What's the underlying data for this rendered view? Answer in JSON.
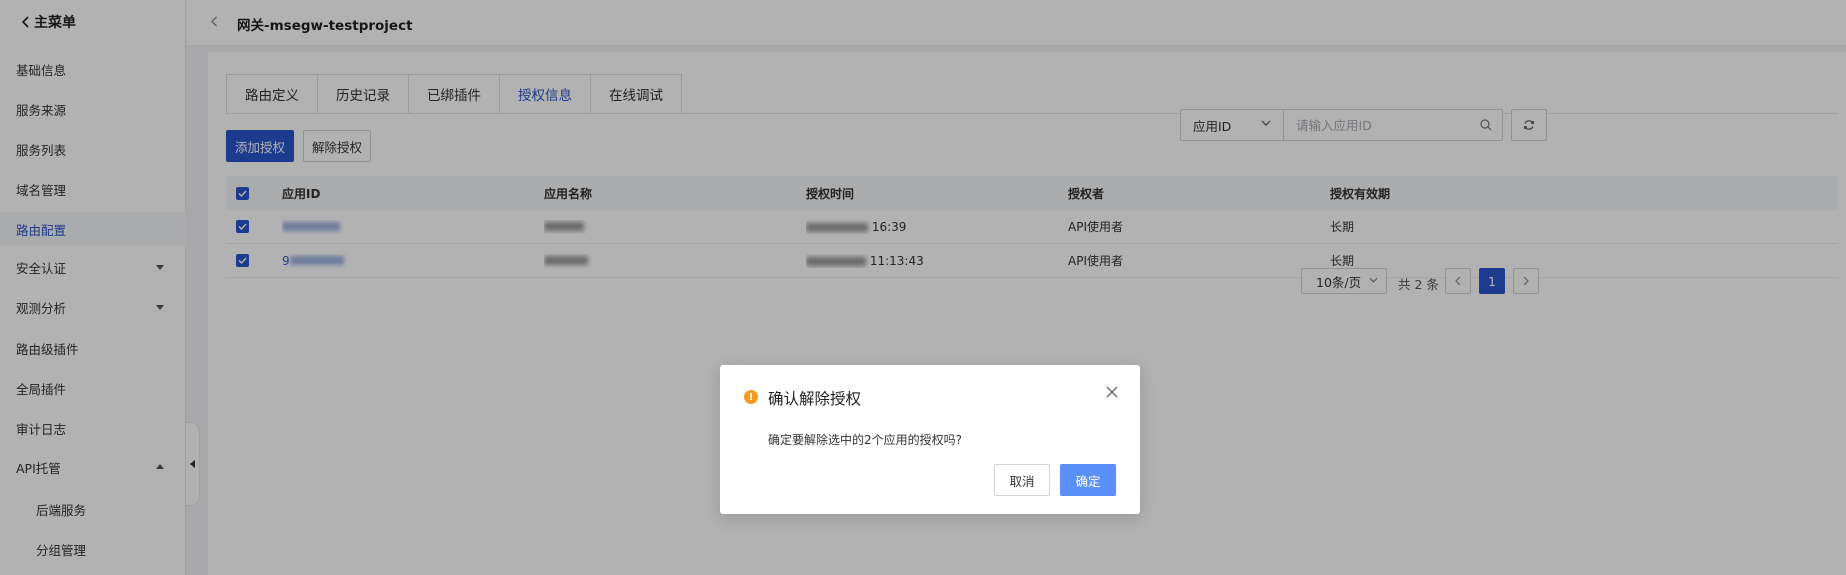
{
  "sidebar": {
    "main_menu": "主菜单",
    "items": [
      {
        "label": "基础信息"
      },
      {
        "label": "服务来源"
      },
      {
        "label": "服务列表"
      },
      {
        "label": "域名管理"
      },
      {
        "label": "路由配置"
      },
      {
        "label": "安全认证"
      },
      {
        "label": "观测分析"
      },
      {
        "label": "路由级插件"
      },
      {
        "label": "全局插件"
      },
      {
        "label": "审计日志"
      },
      {
        "label": "API托管"
      },
      {
        "label": "后端服务"
      },
      {
        "label": "分组管理"
      }
    ]
  },
  "header": {
    "title": "网关-msegw-testproject"
  },
  "tabs": [
    "路由定义",
    "历史记录",
    "已绑插件",
    "授权信息",
    "在线调试"
  ],
  "toolbar": {
    "add_label": "添加授权",
    "remove_label": "解除授权",
    "filter_value": "应用ID",
    "search_placeholder": "请输入应用ID"
  },
  "table": {
    "columns": [
      "应用ID",
      "应用名称",
      "授权时间",
      "授权者",
      "授权有效期"
    ],
    "rows": [
      {
        "app_id": "",
        "app_name": "",
        "time": "16:39",
        "grantor": "API使用者",
        "validity": "长期"
      },
      {
        "app_id": "9",
        "app_name": "",
        "time": "11:13:43",
        "grantor": "API使用者",
        "validity": "长期"
      }
    ]
  },
  "pagination": {
    "page_size": "10条/页",
    "total": "共 2 条",
    "current": "1"
  },
  "modal": {
    "title": "确认解除授权",
    "body": "确定要解除选中的2个应用的授权吗?",
    "cancel": "取消",
    "ok": "确定"
  },
  "colors": {
    "primary": "#2a55cc",
    "modal_ok": "#5b8ff9",
    "warning": "#f59a23"
  }
}
